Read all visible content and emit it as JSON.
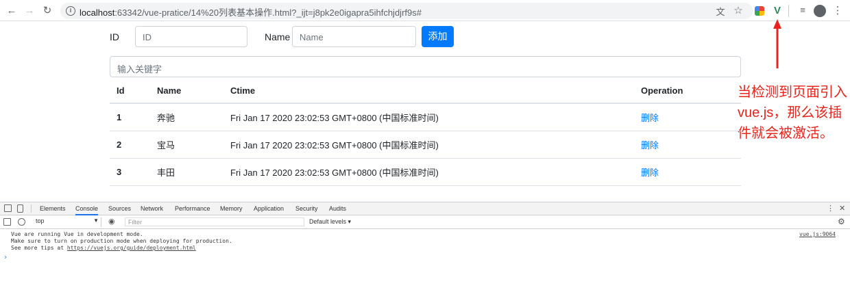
{
  "browser": {
    "url_host": "localhost",
    "url_rest": ":63342/vue-pratice/14%20列表基本操作.html?_ijt=j8pk2e0igapra5ihfchjdjrf9s#"
  },
  "form": {
    "id_label": "ID",
    "id_placeholder": "ID",
    "name_label": "Name",
    "name_placeholder": "Name",
    "add_button": "添加",
    "search_placeholder": "输入关键字"
  },
  "table": {
    "headers": [
      "Id",
      "Name",
      "Ctime",
      "Operation"
    ],
    "rows": [
      {
        "id": "1",
        "name": "奔驰",
        "ctime": "Fri Jan 17 2020 23:02:53 GMT+0800 (中国标准时间)",
        "op": "删除"
      },
      {
        "id": "2",
        "name": "宝马",
        "ctime": "Fri Jan 17 2020 23:02:53 GMT+0800 (中国标准时间)",
        "op": "删除"
      },
      {
        "id": "3",
        "name": "丰田",
        "ctime": "Fri Jan 17 2020 23:02:53 GMT+0800 (中国标准时间)",
        "op": "删除"
      }
    ]
  },
  "annotation": {
    "text": "当检测到页面引入vue.js，那么该插件就会被激活。"
  },
  "devtools": {
    "tabs": [
      "Elements",
      "Console",
      "Sources",
      "Network",
      "Performance",
      "Memory",
      "Application",
      "Security",
      "Audits"
    ],
    "active_tab": "Console",
    "context": "top",
    "filter_placeholder": "Filter",
    "levels": "Default levels",
    "log_line1": "Vue are running Vue in development mode.",
    "log_line2": "Make sure to turn on production mode when deploying for production.",
    "log_line3_prefix": "See more tips at ",
    "log_link": "https://vuejs.org/guide/deployment.html",
    "log_source": "vue.js:9064",
    "prompt": "›"
  },
  "colors": {
    "primary": "#007bff",
    "annotation": "#e8241c",
    "vue_extension": "#2f8a5b"
  }
}
